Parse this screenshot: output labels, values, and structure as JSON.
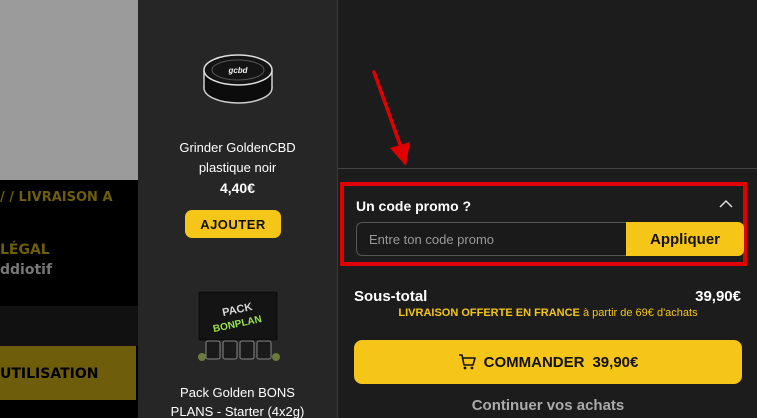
{
  "background_page": {
    "breadcrumb": "/  /  LIVRAISON A",
    "legal_title": "LÉGAL",
    "addictive_text": "ddiotif",
    "usage_label": "UTILISATION"
  },
  "products": [
    {
      "name_line1": "Grinder GoldenCBD",
      "name_line2": "plastique noir",
      "price": "4,40€",
      "add_label": "AJOUTER"
    },
    {
      "name_line1": "Pack Golden BONS",
      "name_line2": "PLANS - Starter (4x2g)"
    }
  ],
  "cart": {
    "promo": {
      "title": "Un code promo ?",
      "placeholder": "Entre ton code promo",
      "apply_label": "Appliquer"
    },
    "subtotal_label": "Sous-total",
    "subtotal_value": "39,90€",
    "shipping_bold": "LIVRAISON OFFERTE EN FRANCE",
    "shipping_rest": " à partir de 69€ d'achats",
    "order_label": "COMMANDER",
    "order_amount": "39,90€",
    "continue_label": "Continuer vos achats"
  },
  "colors": {
    "accent": "#f5c518",
    "highlight": "#e00000"
  },
  "icons": [
    "chevron-up-icon",
    "cart-icon",
    "arrow-annotation"
  ]
}
